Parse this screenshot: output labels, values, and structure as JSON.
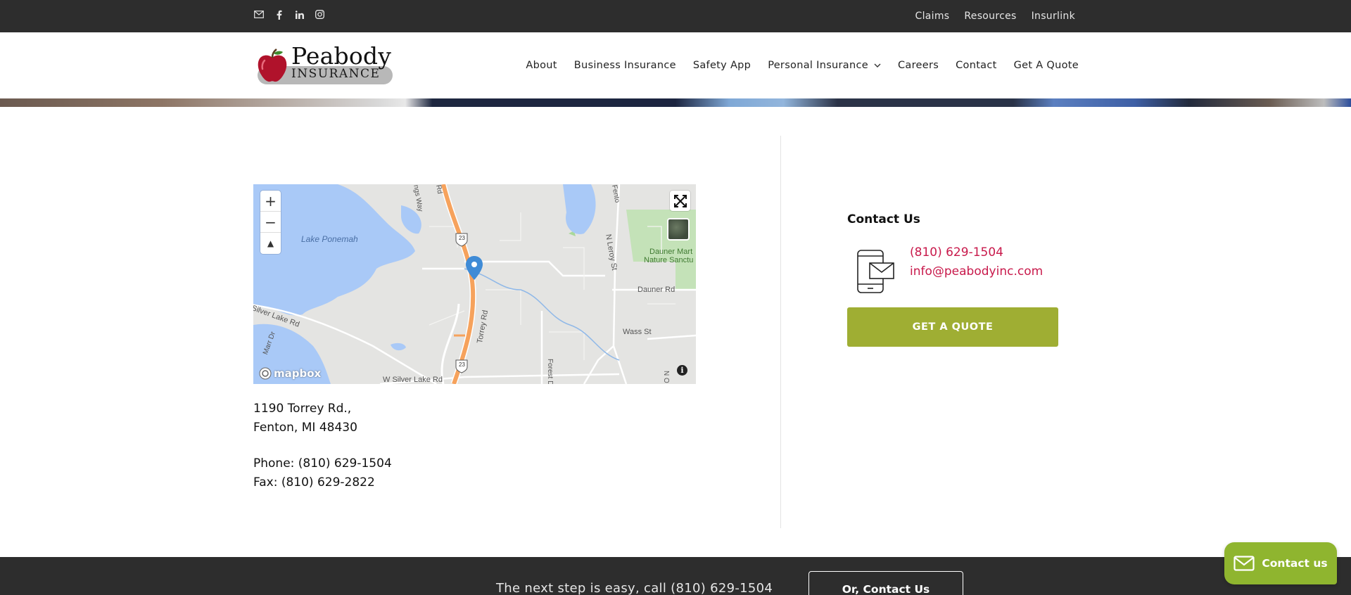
{
  "topbar": {
    "social": [
      "email-icon",
      "facebook-icon",
      "linkedin-icon",
      "instagram-icon"
    ],
    "links": [
      "Claims",
      "Resources",
      "Insurlink"
    ]
  },
  "header": {
    "logo_word1": "Peabody",
    "logo_word2": "INSURANCE",
    "nav": {
      "about": "About",
      "business": "Business Insurance",
      "safety": "Safety App",
      "personal": "Personal Insurance",
      "careers": "Careers",
      "contact": "Contact",
      "quote": "Get A Quote"
    }
  },
  "map": {
    "zoom_in": "+",
    "zoom_out": "−",
    "compass": "▲",
    "attribution": "mapbox",
    "info": "i",
    "labels": {
      "lake": "Lake Ponemah",
      "silver_lake": "Silver Lake Rd",
      "torrey": "Torrey Rd",
      "w_silver": "W Silver Lake Rd",
      "n_leroy": "N Leroy St",
      "dauner_rd": "Dauner Rd",
      "wass": "Wass St",
      "dauner_sanct": "Dauner Mart",
      "dauner_sanct2": "Nature Sanctu",
      "forest": "Forest D",
      "route": "23",
      "route2": "23",
      "marr": "Marr Dr",
      "ways": "ngs Way",
      "rd_top": "Rd",
      "fento": "Fento",
      "n_o": "N O"
    }
  },
  "address": {
    "line1": "1190 Torrey Rd.,",
    "line2": "Fenton, MI 48430",
    "phone": "Phone: (810) 629-1504",
    "fax": "Fax: (810) 629-2822"
  },
  "contact": {
    "title": "Contact Us",
    "phone": "(810) 629-1504",
    "email": "info@peabodyinc.com",
    "quote_button": "GET A QUOTE"
  },
  "footer": {
    "cta_text": "The next step is easy, call (810) 629-1504",
    "contact_button": "Or, Contact Us"
  },
  "chat": {
    "label": "Contact us"
  },
  "colors": {
    "accent_green": "#9fae33",
    "link_red": "#c8194b",
    "dark_bar": "#2d2d2d"
  }
}
